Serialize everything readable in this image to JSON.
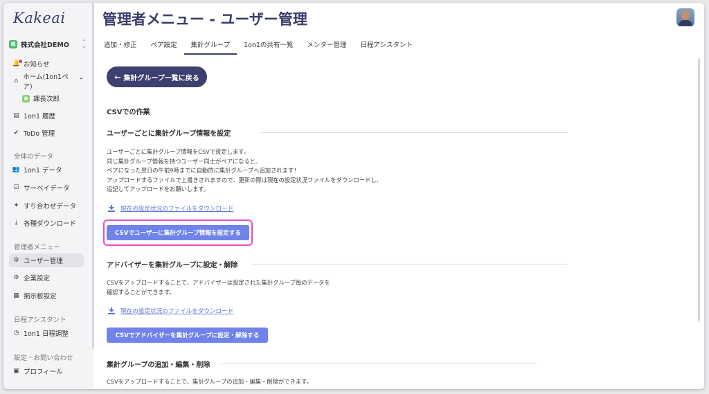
{
  "app": {
    "logo": "Kakeai",
    "org_name": "株式会社DEMO",
    "org_badge": "株"
  },
  "sidebar": {
    "items_top": [
      {
        "label": "お知らせ",
        "icon": "bell-icon"
      },
      {
        "label": "ホーム(1on1ペア)",
        "icon": "home-icon"
      },
      {
        "label": "課長次郎",
        "icon": "user-icon"
      },
      {
        "label": "1on1 履歴",
        "icon": "history-icon"
      },
      {
        "label": "ToDo 管理",
        "icon": "check-icon"
      }
    ],
    "section_all": "全体のデータ",
    "items_all": [
      {
        "label": "1on1 データ",
        "icon": "people-icon"
      },
      {
        "label": "サーベイデータ",
        "icon": "survey-icon"
      },
      {
        "label": "すり合わせデータ",
        "icon": "handshake-icon"
      },
      {
        "label": "各種ダウンロード",
        "icon": "download-icon"
      }
    ],
    "section_admin": "管理者メニュー",
    "items_admin": [
      {
        "label": "ユーザー管理",
        "icon": "user-gear-icon"
      },
      {
        "label": "企業設定",
        "icon": "building-gear-icon"
      },
      {
        "label": "掲示板設定",
        "icon": "board-icon"
      }
    ],
    "section_schedule": "日程アシスタント",
    "items_schedule": [
      {
        "label": "1on1 日程調整",
        "icon": "clock-icon"
      }
    ],
    "section_settings": "設定・お問い合わせ",
    "items_settings": [
      {
        "label": "プロフィール",
        "icon": "profile-icon"
      }
    ]
  },
  "header": {
    "title": "管理者メニュー - ユーザー管理",
    "tabs": [
      "追加・修正",
      "ペア設定",
      "集計グループ",
      "1on1の共有一覧",
      "メンター管理",
      "日程アシスタント"
    ],
    "active_tab": "集計グループ"
  },
  "main": {
    "back_button": "集計グループ一覧に戻る",
    "csv_heading": "CSVでの作業",
    "section1": {
      "title": "ユーザーごとに集計グループ情報を設定",
      "lines": [
        "ユーザーごとに集計グループ情報をCSVで設定します。",
        "同じ集計グループ情報を持つユーザー同士がペアになると、",
        "ペアになった翌日の午前9時までに自動的に集計グループへ追加されます！",
        "アップロードするファイルで上書きされますので、更新の際は現在の設定状況ファイルをダウンロードし、",
        "追記してアップロードをお願いします。"
      ],
      "download_link": "現在の設定状況のファイルをダウンロード",
      "button": "CSVでユーザーに集計グループ情報を設定する"
    },
    "section2": {
      "title": "アドバイザーを集計グループに設定・解除",
      "lines": [
        "CSVをアップロードすることで、アドバイザーは設定された集計グループ毎のデータを",
        "確認することができます。"
      ],
      "download_link": "現在の設定状況のファイルをダウンロード",
      "button": "CSVでアドバイザーを集計グループに設定・解除する"
    },
    "section3": {
      "title": "集計グループの追加・編集・削除",
      "lines": [
        "CSVをアップロードすることで、集計グループの追加・編集・削除ができます。"
      ]
    }
  },
  "colors": {
    "brand": "#3a3d6b",
    "button": "#6f83ea",
    "link": "#5b76d9",
    "highlight": "#e84bc2"
  }
}
